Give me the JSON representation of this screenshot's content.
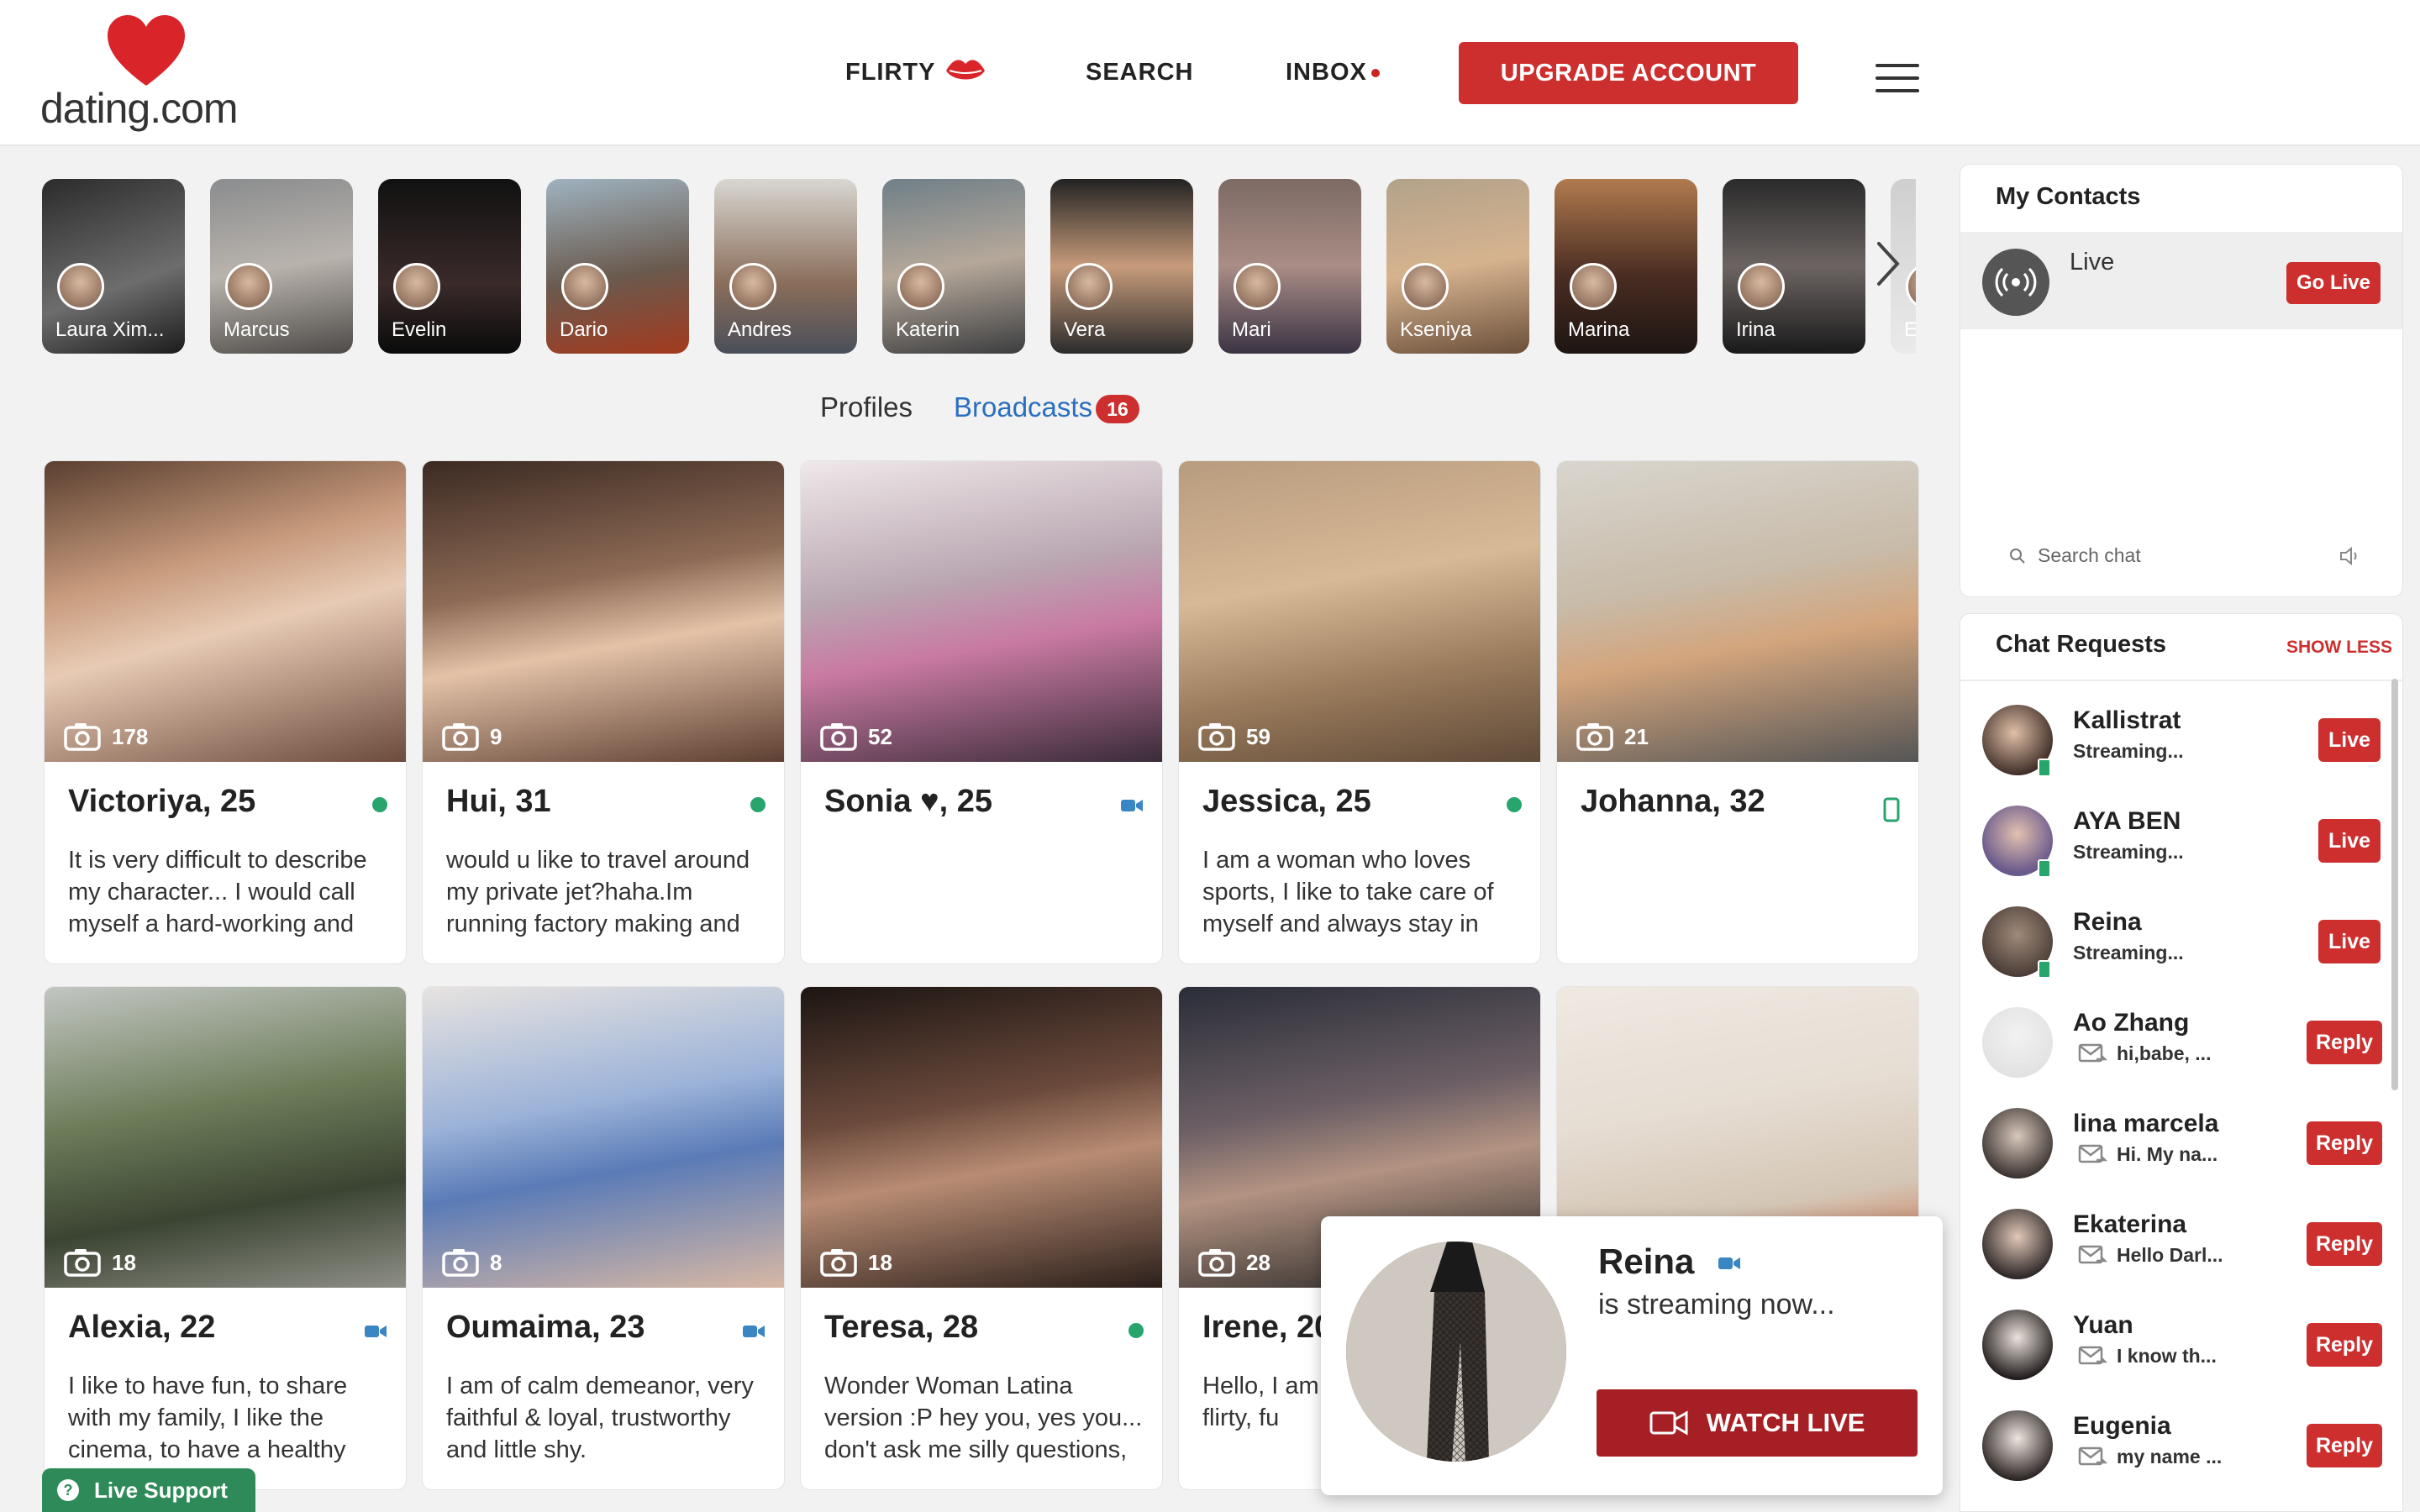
{
  "header": {
    "logo": "dating.com",
    "nav": {
      "flirty": "FLIRTY",
      "search": "SEARCH",
      "inbox": "INBOX"
    },
    "upgrade": "UPGRADE ACCOUNT"
  },
  "stories": [
    {
      "name": "Laura Ximena",
      "display": "Laura Xim..."
    },
    {
      "name": "Marcus",
      "display": "Marcus"
    },
    {
      "name": "Evelin",
      "display": "Evelin"
    },
    {
      "name": "Dario",
      "display": "Dario"
    },
    {
      "name": "Andres",
      "display": "Andres"
    },
    {
      "name": "Katerin",
      "display": "Katerin"
    },
    {
      "name": "Vera",
      "display": "Vera"
    },
    {
      "name": "Mari",
      "display": "Mari"
    },
    {
      "name": "Kseniya",
      "display": "Kseniya"
    },
    {
      "name": "Marina",
      "display": "Marina"
    },
    {
      "name": "Irina",
      "display": "Irina"
    },
    {
      "name": "E",
      "display": "E"
    }
  ],
  "tabs": {
    "profiles": "Profiles",
    "broadcasts": "Broadcasts",
    "broadcasts_count": "16"
  },
  "cards": [
    {
      "name": "Victoriya, 25",
      "photos": "178",
      "status": "online",
      "bio": "It is very difficult to describe my character... I would call myself a hard-working and"
    },
    {
      "name": "Hui, 31",
      "photos": "9",
      "status": "online",
      "bio": "would u like to travel around my private jet?haha.Im running factory making and exporting"
    },
    {
      "name": "Sonia ♥, 25",
      "photos": "52",
      "status": "video",
      "bio": ""
    },
    {
      "name": "Jessica, 25",
      "photos": "59",
      "status": "online",
      "bio": "I am a woman who loves sports, I like to take care of myself and always stay in"
    },
    {
      "name": "Johanna, 32",
      "photos": "21",
      "status": "mobile",
      "bio": ""
    },
    {
      "name": "Alexia, 22",
      "photos": "18",
      "status": "video",
      "bio": "I like to have fun, to share with my family, I like the cinema, to have a healthy"
    },
    {
      "name": "Oumaima, 23",
      "photos": "8",
      "status": "video",
      "bio": "I am of calm demeanor, very faithful & loyal, trustworthy and little shy."
    },
    {
      "name": "Teresa, 28",
      "photos": "18",
      "status": "online",
      "bio": "Wonder Woman Latina version :P hey you, yes you... don't ask me silly questions,"
    },
    {
      "name": "Irene, 20",
      "photos": "28",
      "status": "none",
      "bio": "Hello, I am hardworking am flirty, fu"
    },
    {
      "name": "",
      "photos": "",
      "status": "none",
      "bio": ""
    }
  ],
  "contacts": {
    "title": "My Contacts",
    "live_label": "Live",
    "go_live": "Go Live",
    "search_placeholder": "Search chat"
  },
  "requests": {
    "title": "Chat Requests",
    "show_less": "SHOW LESS",
    "items": [
      {
        "name": "Kallistrat",
        "msg": "Streaming...",
        "button": "Live"
      },
      {
        "name": "AYA BEN",
        "msg": "Streaming...",
        "button": "Live"
      },
      {
        "name": "Reina",
        "msg": "Streaming...",
        "button": "Live"
      },
      {
        "name": "Ao Zhang",
        "msg": "hi,babe, ...",
        "button": "Reply"
      },
      {
        "name": "lina marcela",
        "msg": "Hi. My na...",
        "button": "Reply"
      },
      {
        "name": "Ekaterina",
        "msg": "Hello Darl...",
        "button": "Reply"
      },
      {
        "name": "Yuan",
        "msg": "I know th...",
        "button": "Reply"
      },
      {
        "name": "Eugenia",
        "msg": "my name ...",
        "button": "Reply"
      }
    ]
  },
  "popup": {
    "name": "Reina",
    "subtitle": "is streaming now...",
    "button": "WATCH LIVE"
  },
  "live_support": "Live Support",
  "colors": {
    "brand_red": "#cd2f2f",
    "link_blue": "#2a6fc0",
    "online_green": "#27a56c",
    "video_blue": "#3a86c4"
  }
}
